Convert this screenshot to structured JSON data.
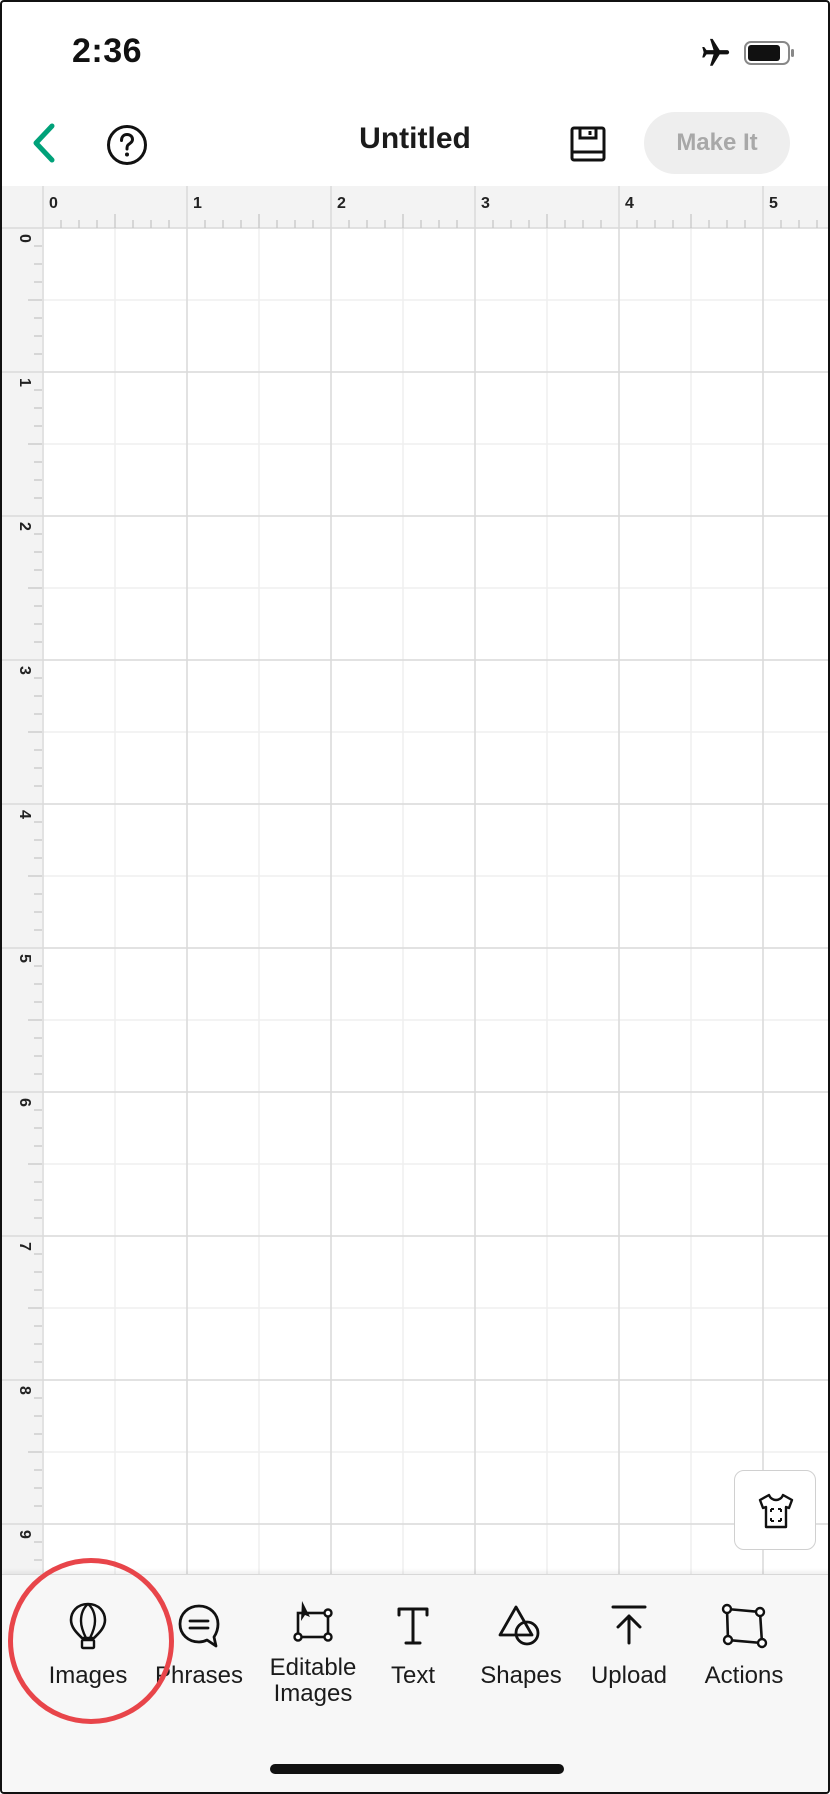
{
  "status": {
    "time": "2:36"
  },
  "header": {
    "title": "Untitled",
    "make_it_label": "Make It"
  },
  "colors": {
    "accent": "#00a179",
    "highlight": "#e8454a",
    "disabled_button_bg": "#eeeeee",
    "disabled_button_text": "#a8a8a8"
  },
  "ruler": {
    "x_labels": [
      "0",
      "1",
      "2",
      "3",
      "4",
      "5"
    ],
    "y_labels": [
      "0",
      "1",
      "2",
      "3",
      "4",
      "5",
      "6",
      "7",
      "8",
      "9"
    ]
  },
  "toolbar": {
    "items": [
      {
        "label": "Images",
        "icon": "hot-air-balloon-icon"
      },
      {
        "label": "Phrases",
        "icon": "speech-bubble-icon"
      },
      {
        "label": "Editable Images",
        "line1": "Editable",
        "line2": "Images",
        "icon": "editable-shape-icon"
      },
      {
        "label": "Text",
        "icon": "text-t-icon"
      },
      {
        "label": "Shapes",
        "icon": "shapes-icon"
      },
      {
        "label": "Upload",
        "icon": "upload-icon"
      },
      {
        "label": "Actions",
        "icon": "actions-icon"
      }
    ]
  }
}
